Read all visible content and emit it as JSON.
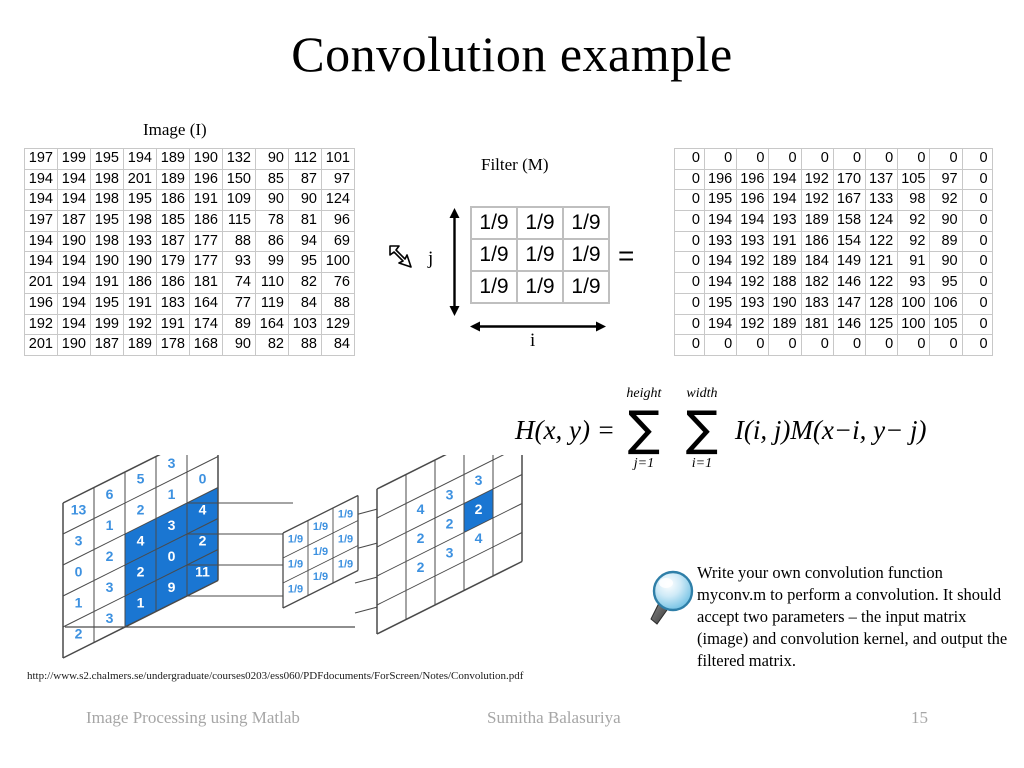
{
  "slide": {
    "title": "Convolution example",
    "page_number": "15",
    "source_url": "http://www.s2.chalmers.se/undergraduate/courses0203/ess060/PDFdocuments/ForScreen/Notes/Convolution.pdf"
  },
  "labels": {
    "image": "Image (I)",
    "filter": "Filter (M)",
    "axis_i": "i",
    "axis_j": "j",
    "equals": "="
  },
  "image_matrix": {
    "rows": [
      [
        "197",
        "199",
        "195",
        "194",
        "189",
        "190",
        "132",
        "90",
        "112",
        "101"
      ],
      [
        "194",
        "194",
        "198",
        "201",
        "189",
        "196",
        "150",
        "85",
        "87",
        "97"
      ],
      [
        "194",
        "194",
        "198",
        "195",
        "186",
        "191",
        "109",
        "90",
        "90",
        "124"
      ],
      [
        "197",
        "187",
        "195",
        "198",
        "185",
        "186",
        "115",
        "78",
        "81",
        "96"
      ],
      [
        "194",
        "190",
        "198",
        "193",
        "187",
        "177",
        "88",
        "86",
        "94",
        "69"
      ],
      [
        "194",
        "194",
        "190",
        "190",
        "179",
        "177",
        "93",
        "99",
        "95",
        "100"
      ],
      [
        "201",
        "194",
        "191",
        "186",
        "186",
        "181",
        "74",
        "110",
        "82",
        "76"
      ],
      [
        "196",
        "194",
        "195",
        "191",
        "183",
        "164",
        "77",
        "119",
        "84",
        "88"
      ],
      [
        "192",
        "194",
        "199",
        "192",
        "191",
        "174",
        "89",
        "164",
        "103",
        "129"
      ],
      [
        "201",
        "190",
        "187",
        "189",
        "178",
        "168",
        "90",
        "82",
        "88",
        "84"
      ]
    ]
  },
  "filter_matrix": {
    "rows": [
      [
        "1/9",
        "1/9",
        "1/9"
      ],
      [
        "1/9",
        "1/9",
        "1/9"
      ],
      [
        "1/9",
        "1/9",
        "1/9"
      ]
    ]
  },
  "result_matrix": {
    "rows": [
      [
        "0",
        "0",
        "0",
        "0",
        "0",
        "0",
        "0",
        "0",
        "0",
        "0"
      ],
      [
        "0",
        "196",
        "196",
        "194",
        "192",
        "170",
        "137",
        "105",
        "97",
        "0"
      ],
      [
        "0",
        "195",
        "196",
        "194",
        "192",
        "167",
        "133",
        "98",
        "92",
        "0"
      ],
      [
        "0",
        "194",
        "194",
        "193",
        "189",
        "158",
        "124",
        "92",
        "90",
        "0"
      ],
      [
        "0",
        "193",
        "193",
        "191",
        "186",
        "154",
        "122",
        "92",
        "89",
        "0"
      ],
      [
        "0",
        "194",
        "192",
        "189",
        "184",
        "149",
        "121",
        "91",
        "90",
        "0"
      ],
      [
        "0",
        "194",
        "192",
        "188",
        "182",
        "146",
        "122",
        "93",
        "95",
        "0"
      ],
      [
        "0",
        "195",
        "193",
        "190",
        "183",
        "147",
        "128",
        "100",
        "106",
        "0"
      ],
      [
        "0",
        "194",
        "192",
        "189",
        "181",
        "146",
        "125",
        "100",
        "105",
        "0"
      ],
      [
        "0",
        "0",
        "0",
        "0",
        "0",
        "0",
        "0",
        "0",
        "0",
        "0"
      ]
    ]
  },
  "formula": {
    "lhs": "H(x, y) =",
    "sum_outer": {
      "top": "height",
      "bottom": "j=1",
      "symbol": "∑"
    },
    "sum_inner": {
      "top": "width",
      "bottom": "i=1",
      "symbol": "∑"
    },
    "rhs": "I(i, j)M(x−i, y− j)"
  },
  "diagram": {
    "input_grid": {
      "cells": [
        "13",
        "6",
        "5",
        "3",
        "5",
        "3",
        "1",
        "2",
        "1",
        "0",
        "0",
        "2",
        "4",
        "3",
        "4",
        "1",
        "3",
        "2",
        "0",
        "2",
        "2",
        "3",
        "1",
        "9",
        "11"
      ],
      "highlighted": [
        "4",
        "3",
        "4",
        "2",
        "0",
        "2",
        "1",
        "9",
        "11"
      ]
    },
    "kernel_grid": {
      "cells": [
        "1/9",
        "1/9",
        "1/9",
        "1/9",
        "1/9",
        "1/9",
        "1/9",
        "1/9",
        "1/9"
      ]
    },
    "output_grid": {
      "cells": [
        "4",
        "3",
        "3",
        "2",
        "2",
        "2",
        "2",
        "3",
        "4"
      ],
      "highlighted_value": "4"
    },
    "accent_color": "#1a76d2",
    "text_color": "#3d91e0"
  },
  "note": {
    "text": "Write your own convolution function myconv.m to perform a convolution. It should accept two parameters – the input matrix (image) and convolution kernel, and output the filtered matrix."
  },
  "footer": {
    "left": "Image Processing using Matlab",
    "center": "Sumitha Balasuriya"
  }
}
